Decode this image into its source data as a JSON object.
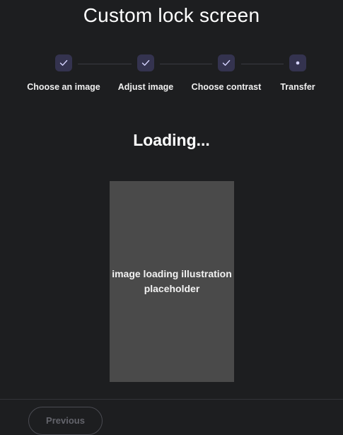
{
  "page": {
    "title": "Custom lock screen"
  },
  "stepper": {
    "steps": [
      {
        "label": "Choose an image",
        "state": "complete",
        "icon": "checkmark-icon"
      },
      {
        "label": "Adjust image",
        "state": "complete",
        "icon": "checkmark-icon"
      },
      {
        "label": "Choose contrast",
        "state": "complete",
        "icon": "checkmark-icon"
      },
      {
        "label": "Transfer",
        "state": "current",
        "icon": "dot-icon"
      }
    ]
  },
  "main": {
    "loading_text": "Loading...",
    "placeholder_text": "image loading illustration placeholder"
  },
  "footer": {
    "previous_label": "Previous",
    "previous_disabled": true
  },
  "colors": {
    "background": "#1d1e20",
    "step_badge": "#34334f",
    "step_icon": "#d6d4ff",
    "placeholder": "#4a4a4a"
  }
}
